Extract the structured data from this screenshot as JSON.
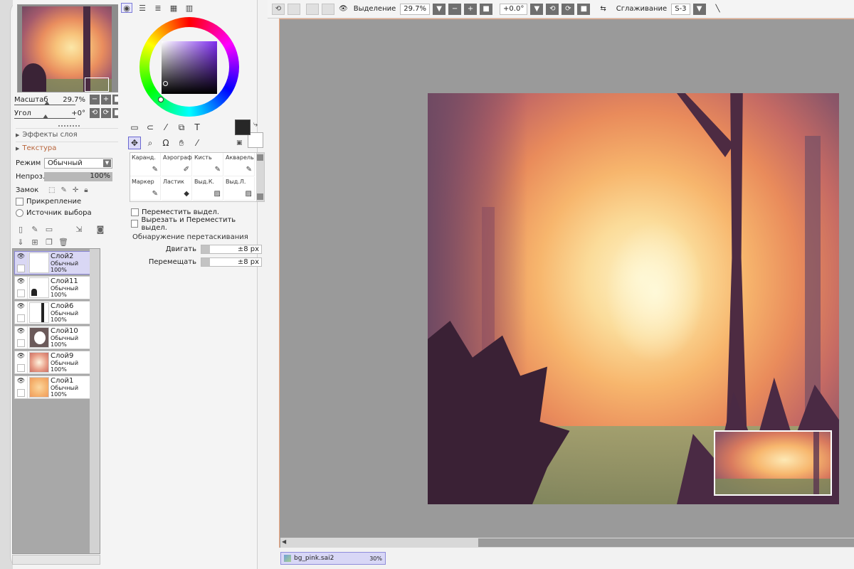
{
  "navigator": {
    "zoom_label": "Масштаб",
    "zoom_value": "29.7%",
    "angle_label": "Угол",
    "angle_value": "+0°"
  },
  "layer_panel": {
    "effects_label": "Эффекты слоя",
    "texture_label": "Текстура",
    "mode_label": "Режим",
    "mode_value": "Обычный",
    "opacity_label": "Непроз.",
    "opacity_value": "100%",
    "lock_label": "Замок",
    "clipping_label": "Прикрепление",
    "selection_source_label": "Источник выбора",
    "layers": [
      {
        "name": "Слой2",
        "mode": "Обычный",
        "opacity": "100%",
        "thumb": "#ffffff"
      },
      {
        "name": "Слой11",
        "mode": "Обычный",
        "opacity": "100%",
        "thumb": "#ffffff"
      },
      {
        "name": "Слой6",
        "mode": "Обычный",
        "opacity": "100%",
        "thumb": "#ffffff"
      },
      {
        "name": "Слой10",
        "mode": "Обычный",
        "opacity": "100%",
        "thumb": "#6b5a5a"
      },
      {
        "name": "Слой9",
        "mode": "Обычный",
        "opacity": "100%",
        "thumb": "#d9897a"
      },
      {
        "name": "Слой1",
        "mode": "Обычный",
        "opacity": "100%",
        "thumb": "#f5b26e"
      }
    ]
  },
  "tools": {
    "text_tool_glyph": "T",
    "brushes": [
      {
        "label": "Каранд."
      },
      {
        "label": "Аэрограф"
      },
      {
        "label": "Кисть"
      },
      {
        "label": "Акварель"
      },
      {
        "label": "Маркер"
      },
      {
        "label": "Ластик"
      },
      {
        "label": "Выд.К."
      },
      {
        "label": "Выд.Л."
      }
    ],
    "move_selection_label": "Переместить выдел.",
    "cut_move_selection_label": "Вырезать и Переместить выдел.",
    "drag_detection_title": "Обнаружение перетаскивания",
    "drag_label": "Двигать",
    "drag_value": "±8 px",
    "move_label": "Перемещать",
    "move_value": "±8 px"
  },
  "toolbar": {
    "selection_label": "Выделение",
    "zoom_value": "29.7%",
    "angle_value": "+0.0°",
    "smoothing_label": "Сглаживание",
    "smoothing_value": "S-3"
  },
  "file_tab": {
    "name": "bg_pink.sai2",
    "zoom": "30%"
  },
  "colors": {
    "accent": "#7b7bd8",
    "foreground": "#272727",
    "background": "#ffffff"
  }
}
